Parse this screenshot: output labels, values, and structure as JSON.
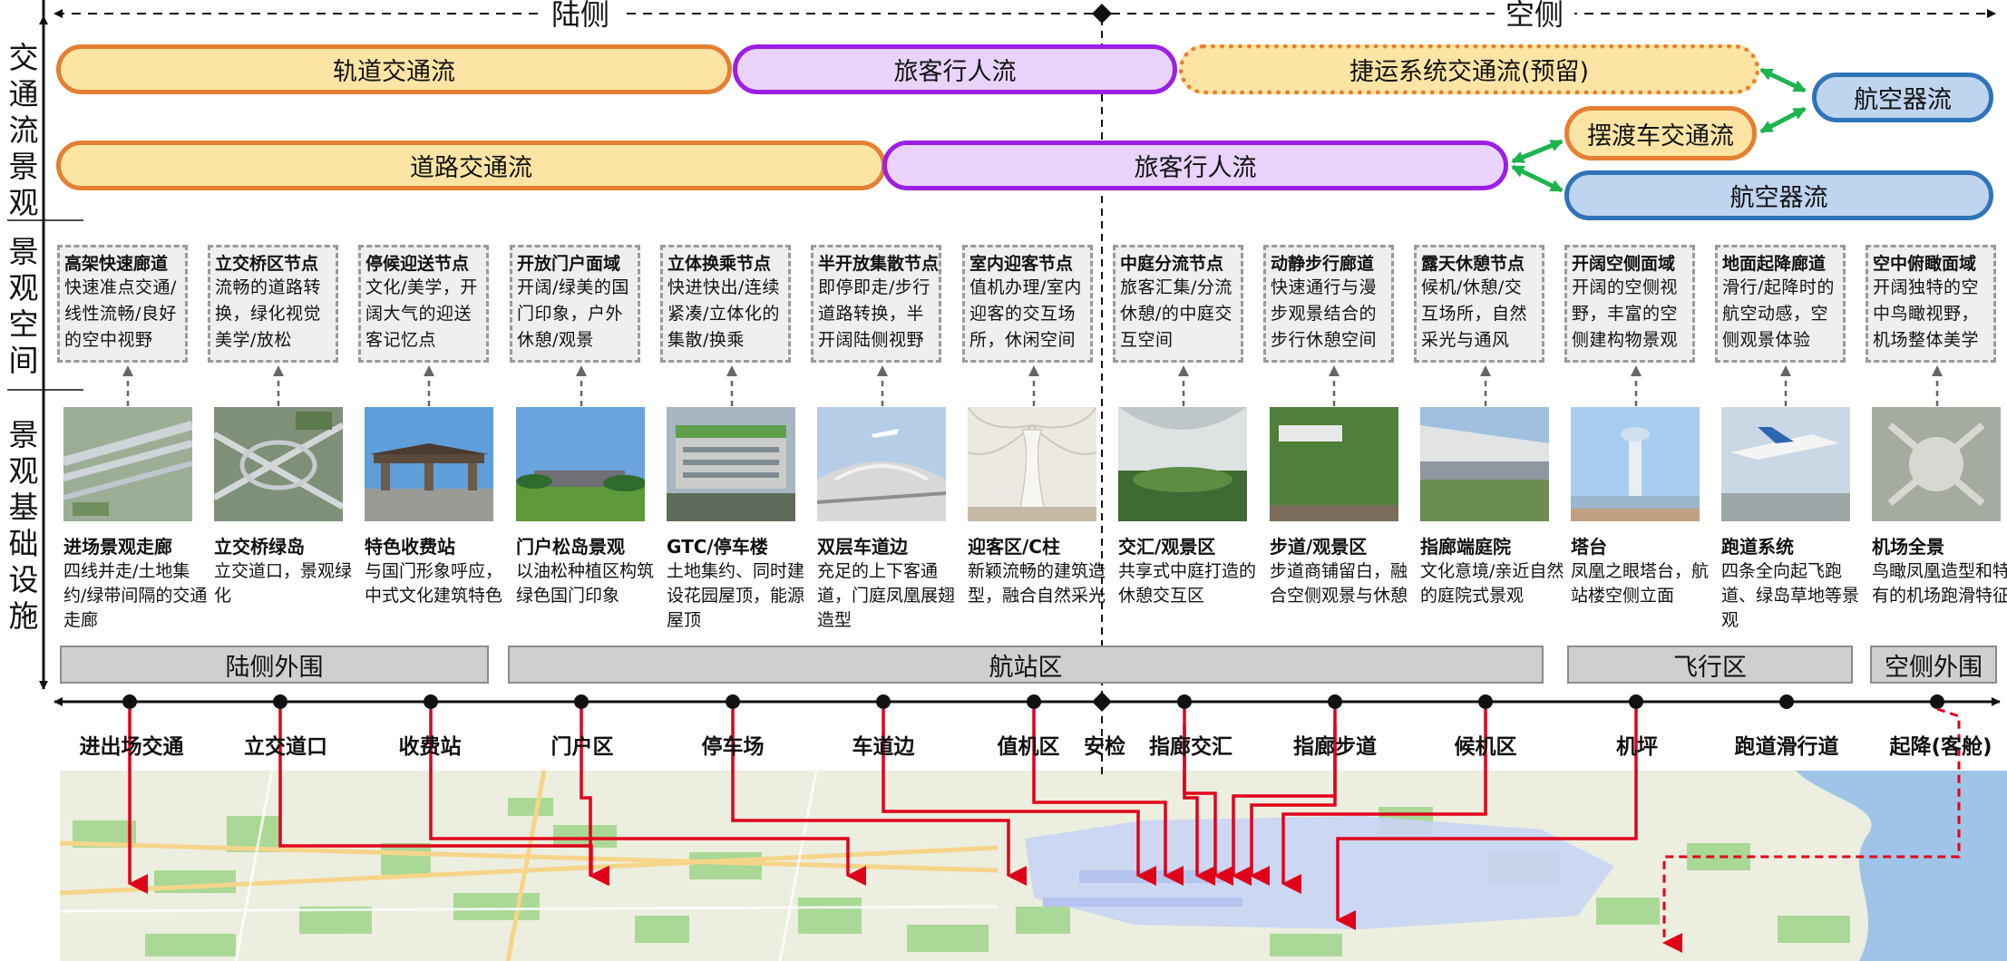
{
  "header": {
    "landside": "陆侧",
    "airside": "空侧"
  },
  "row_labels": {
    "traffic": "交通流景观",
    "space": "景观空间",
    "infra": "景观基础设施"
  },
  "flows": {
    "rail": "轨道交通流",
    "passenger_top": "旅客行人流",
    "apm": "捷运系统交通流(预留)",
    "aircraft_right": "航空器流",
    "road": "道路交通流",
    "passenger_bottom": "旅客行人流",
    "shuttle": "摆渡车交通流",
    "aircraft_bottom": "航空器流"
  },
  "space_cards": [
    {
      "title": "高架快速廊道",
      "desc": "快速准点交通/线性流畅/良好的空中视野"
    },
    {
      "title": "立交桥区节点",
      "desc": "流畅的道路转换，绿化视觉美学/放松"
    },
    {
      "title": "停候迎送节点",
      "desc": "文化/美学，开阔大气的迎送客记忆点"
    },
    {
      "title": "开放门户面域",
      "desc": "开阔/绿美的国门印象，户外休憩/观景"
    },
    {
      "title": "立体换乘节点",
      "desc": "快进快出/连续紧凑/立体化的集散/换乘"
    },
    {
      "title": "半开放集散节点",
      "desc": "即停即走/步行道路转换，半开阔陆侧视野"
    },
    {
      "title": "室内迎客节点",
      "desc": "值机办理/室内迎客的交互场所，休闲空间"
    },
    {
      "title": "中庭分流节点",
      "desc": "旅客汇集/分流休憩/的中庭交互空间"
    },
    {
      "title": "动静步行廊道",
      "desc": "快速通行与漫步观景结合的步行休憩空间"
    },
    {
      "title": "露天休憩节点",
      "desc": "候机/休憩/交互场所，自然采光与通风"
    },
    {
      "title": "开阔空侧面域",
      "desc": "开阔的空侧视野，丰富的空侧建构物景观"
    },
    {
      "title": "地面起降廊道",
      "desc": "滑行/起降时的航空动感，空侧观景体验"
    },
    {
      "title": "空中俯瞰面域",
      "desc": "开阔独特的空中鸟瞰视野，机场整体美学"
    }
  ],
  "infra": [
    {
      "title": "进场景观走廊",
      "desc": "四线并走/土地集约/绿带间隔的交通走廊",
      "photo": "highway-aerial"
    },
    {
      "title": "立交桥绿岛",
      "desc": "立交道口，景观绿化",
      "photo": "interchange-aerial"
    },
    {
      "title": "特色收费站",
      "desc": "与国门形象呼应，中式文化建筑特色",
      "photo": "toll-gate"
    },
    {
      "title": "门户松岛景观",
      "desc": "以油松种植区构筑绿色国门印象",
      "photo": "pine-landscape"
    },
    {
      "title": "GTC/停车楼",
      "desc": "土地集约、同时建设花园屋顶，能源屋顶",
      "photo": "parking-building"
    },
    {
      "title": "双层车道边",
      "desc": "充足的上下客通道，门庭凤凰展翅造型",
      "photo": "curbside"
    },
    {
      "title": "迎客区/C柱",
      "desc": "新颖流畅的建筑造型，融合自然采光",
      "photo": "c-column"
    },
    {
      "title": "交汇/观景区",
      "desc": "共享式中庭打造的休憩交互区",
      "photo": "atrium"
    },
    {
      "title": "步道/观景区",
      "desc": "步道商铺留白，融合空侧观景与休憩",
      "photo": "green-wall"
    },
    {
      "title": "指廊端庭院",
      "desc": "文化意境/亲近自然的庭院式景观",
      "photo": "courtyard"
    },
    {
      "title": "塔台",
      "desc": "凤凰之眼塔台，航站楼空侧立面",
      "photo": "control-tower"
    },
    {
      "title": "跑道系统",
      "desc": "四条全向起飞跑道、绿岛草地等景观",
      "photo": "runway"
    },
    {
      "title": "机场全景",
      "desc": "鸟瞰凤凰造型和特有的机场跑滑特征",
      "photo": "airport-panorama"
    }
  ],
  "zones": {
    "landside_perimeter": "陆侧外围",
    "terminal": "航站区",
    "airfield": "飞行区",
    "airside_perimeter": "空侧外围"
  },
  "axis_labels": [
    "进出场交通",
    "立交道口",
    "收费站",
    "门户区",
    "停车场",
    "车道边",
    "值机区",
    "安检",
    "指廊交汇",
    "指廊步道",
    "候机区",
    "机坪",
    "跑道滑行道",
    "起降(客舱)"
  ],
  "colors": {
    "orange": "#e57f32",
    "purple": "#9b1fe5",
    "blue": "#2f74b8",
    "green": "#1db34f",
    "red": "#e0001a",
    "zone": "#d0cece"
  }
}
